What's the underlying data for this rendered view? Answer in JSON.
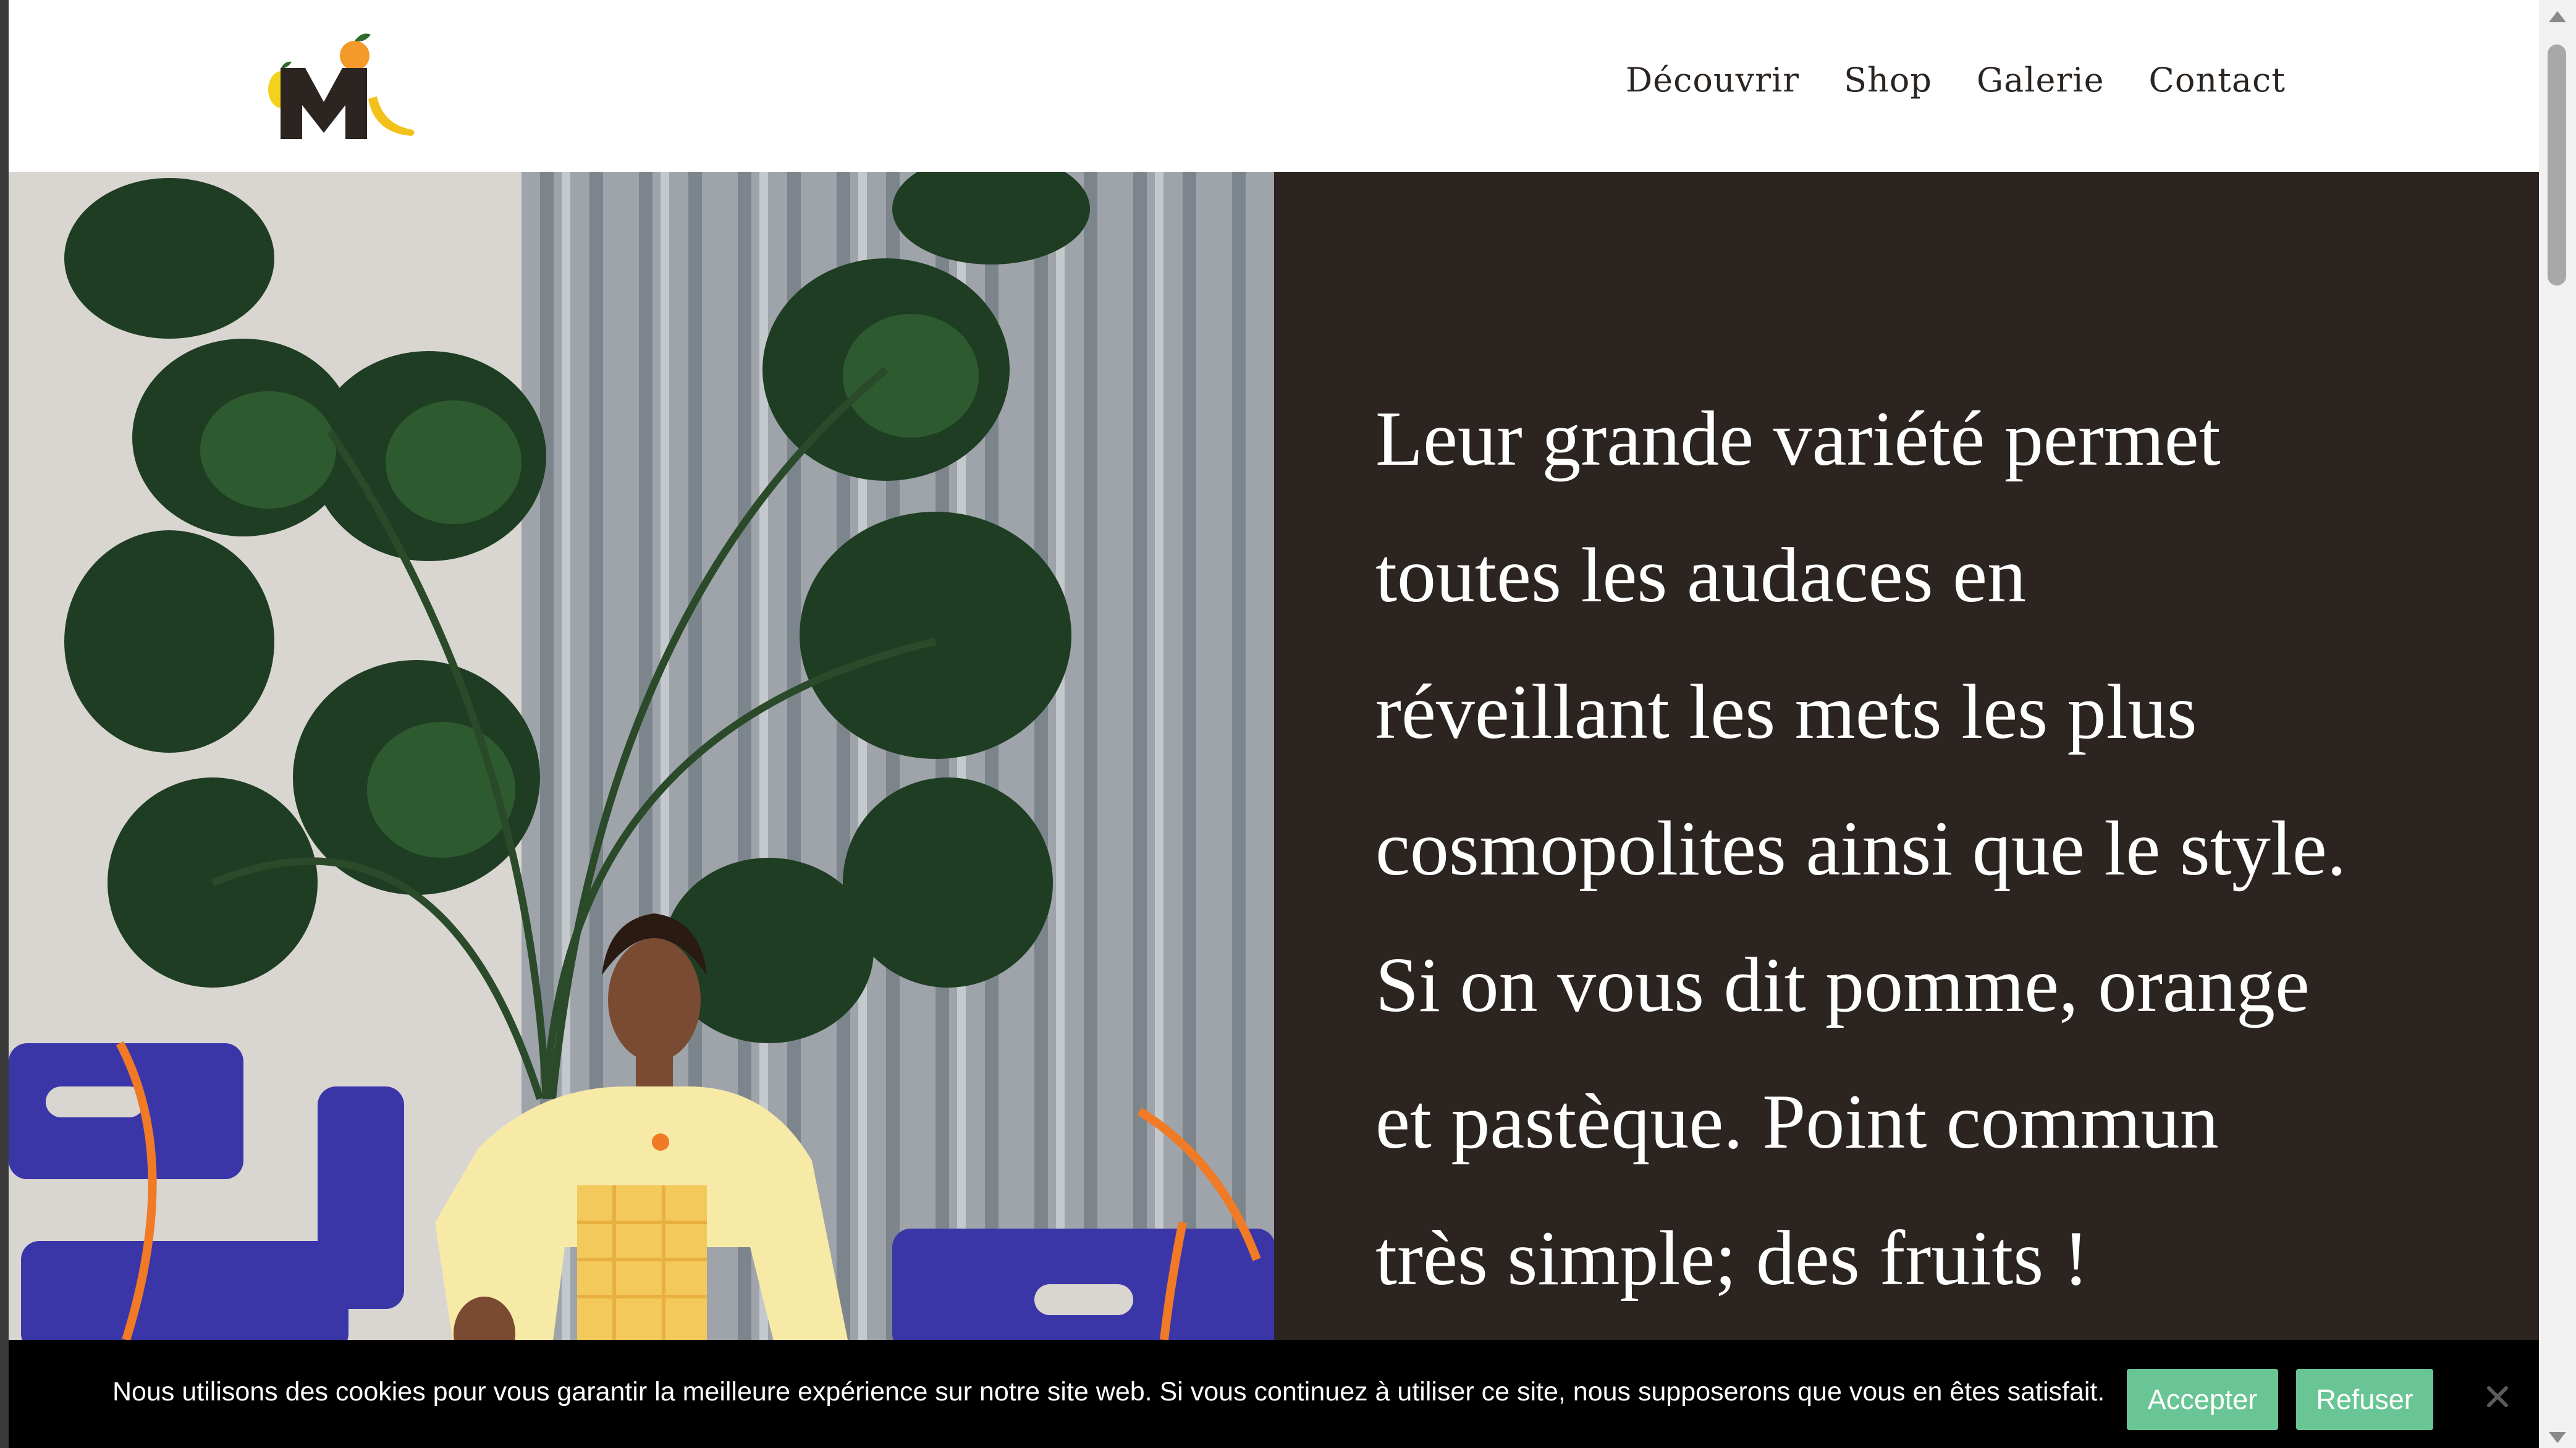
{
  "header": {
    "nav": [
      "Découvrir",
      "Shop",
      "Galerie",
      "Contact"
    ]
  },
  "hero": {
    "lines": [
      "Leur grande variété permet",
      "toutes les audaces en",
      "réveillant les mets les plus",
      "cosmopolites ainsi que le style.",
      "Si on vous dit pomme, orange",
      "et pastèque. Point commun",
      "très simple; des fruits !"
    ]
  },
  "cookie": {
    "message": "Nous utilisons des cookies pour vous garantir la meilleure expérience sur notre site web. Si vous continuez à utiliser ce site, nous supposerons que vous en êtes satisfait.",
    "accept_label": "Accepter",
    "refuse_label": "Refuser"
  },
  "colors": {
    "panel": "#2c2420",
    "cookie_button": "#6ac595",
    "nav_text": "#2b2522"
  },
  "icons": [
    "logo-fruits-icon",
    "close-icon"
  ]
}
